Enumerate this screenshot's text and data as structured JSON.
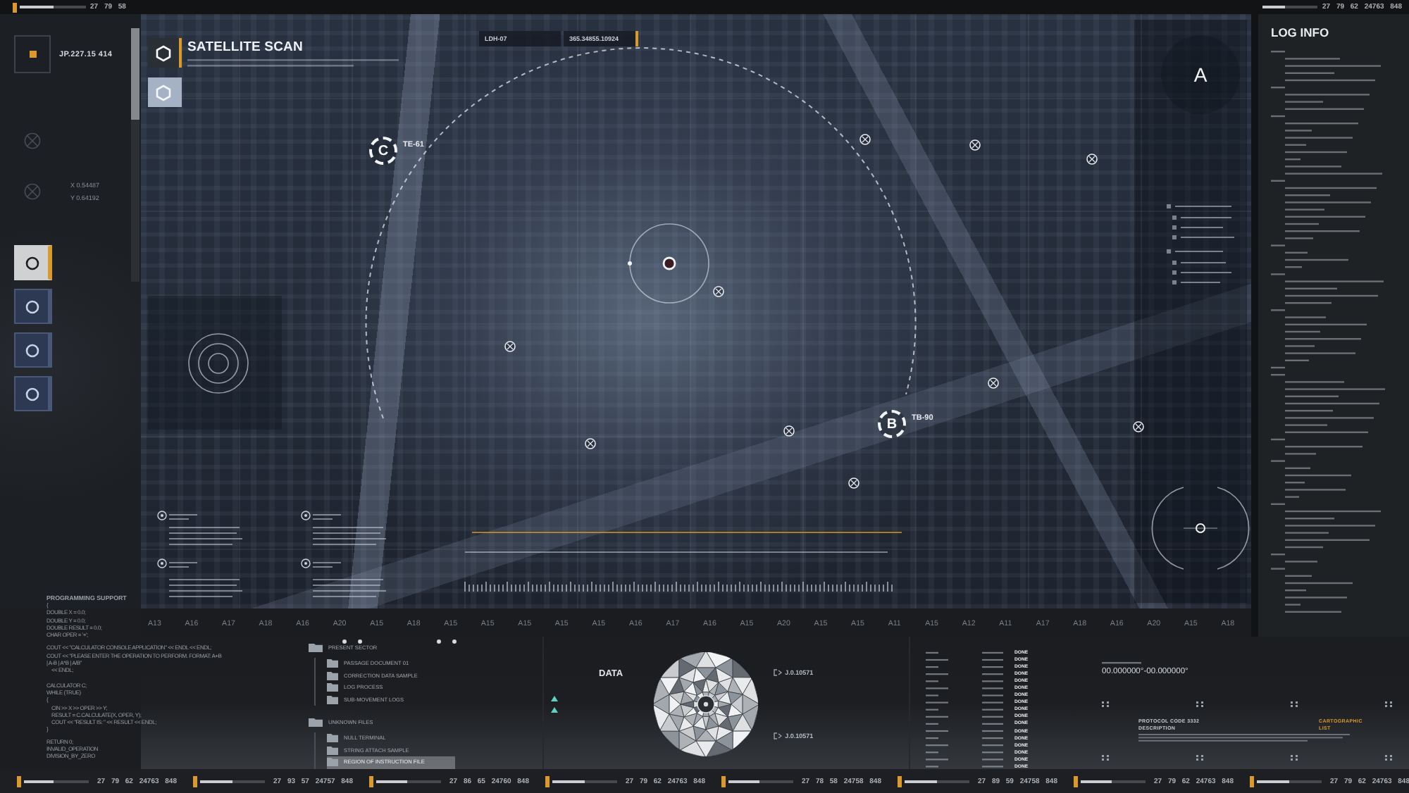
{
  "top_bar": {
    "left": {
      "level": 0.5,
      "readout": "27 79 58"
    },
    "right": {
      "level": 0.42,
      "readout": "27 79 62 24763 848"
    }
  },
  "left_panel": {
    "coordinate": "JP.227.15 414",
    "readouts": [
      "X 0.54487",
      "Y 0.64192"
    ],
    "tools": [
      {
        "selected": true
      },
      {
        "selected": false
      },
      {
        "selected": false
      },
      {
        "selected": false
      }
    ],
    "section_title": "PROGRAMMING SUPPORT"
  },
  "map": {
    "title": "SATELLITE SCAN",
    "scan_modes": [
      {
        "kind": "outline",
        "selected": true
      },
      {
        "kind": "filled",
        "selected": false
      }
    ],
    "location_tag": {
      "label": "LDH-07",
      "value": "365.34855.10924"
    },
    "markers": [
      {
        "kind": "ring",
        "letter": "C",
        "code": "TE-61"
      },
      {
        "kind": "ring",
        "letter": "B",
        "code": "TB-90"
      },
      {
        "kind": "plain",
        "letter": "A"
      }
    ]
  },
  "ruler": [
    "A13",
    "A16",
    "A17",
    "A18",
    "A16",
    "A20",
    "A15",
    "A18",
    "A15",
    "A15",
    "A15",
    "A15",
    "A15",
    "A16",
    "A17",
    "A16",
    "A15",
    "A20",
    "A15",
    "A15",
    "A11",
    "A15",
    "A12",
    "A11",
    "A17",
    "A18",
    "A16",
    "A20",
    "A15",
    "A18"
  ],
  "log_info": {
    "title": "LOG INFO"
  },
  "code_blocks": [
    [
      "{",
      "DOUBLE X = 0.0;",
      "DOUBLE Y = 0.0;",
      "DOUBLE RESULT = 0.0;",
      "CHAR OPER = '+';"
    ],
    [
      "COUT << \"CALCULATOR CONSOLE APPLICATION\" << ENDL << ENDL;",
      "COUT << \"PLEASE ENTER THE OPERATION TO PERFORM. FORMAT: A+B",
      "| A-B | A*B | A/B\"",
      "    << ENDL;"
    ],
    [
      "CALCULATOR C;",
      "WHILE (TRUE)",
      "{",
      "    CIN >> X >> OPER >> Y;",
      "    RESULT = C.CALCULATE(X, OPER, Y);",
      "    COUT << \"RESULT IS: \" << RESULT << ENDL;",
      "}"
    ],
    [
      "RETURN 0;",
      "INVALID_OPERATION",
      "DIVISION_BY_ZERO"
    ]
  ],
  "file_tree": [
    {
      "name": "PRESENT SECTOR",
      "expanded": true,
      "selected": false,
      "children": [
        {
          "name": "PASSAGE DOCUMENT 01",
          "selected": false
        },
        {
          "name": "CORRECTION DATA SAMPLE",
          "selected": false
        },
        {
          "name": "LOG PROCESS",
          "selected": false
        },
        {
          "name": "SUB-MOVEMENT LOGS",
          "selected": false
        }
      ]
    },
    {
      "name": "UNKNOWN FILES",
      "expanded": true,
      "selected": false,
      "children": [
        {
          "name": "NULL TERMINAL",
          "selected": false
        },
        {
          "name": "STRING ATTACH SAMPLE",
          "selected": false
        },
        {
          "name": "REGION OF INSTRUCTION FILE",
          "selected": true
        }
      ]
    }
  ],
  "data_widget": {
    "title": "DATA",
    "readouts": [
      "J.0.10571",
      "J.0.10571"
    ]
  },
  "task_table": {
    "rows": [
      {
        "status": "DONE"
      },
      {
        "status": "DONE"
      },
      {
        "status": "DONE"
      },
      {
        "status": "DONE"
      },
      {
        "status": "DONE"
      },
      {
        "status": "DONE"
      },
      {
        "status": "DONE"
      },
      {
        "status": "DONE"
      },
      {
        "status": "DONE"
      },
      {
        "status": "DONE"
      },
      {
        "status": "DONE"
      },
      {
        "status": "DONE"
      },
      {
        "status": "DONE"
      },
      {
        "status": "DONE"
      },
      {
        "status": "DONE"
      },
      {
        "status": "DONE"
      },
      {
        "status": "DONE"
      }
    ]
  },
  "geocode": {
    "value": "00.000000°-00.000000°"
  },
  "protocol": {
    "code": "PROTOCOL CODE 3332",
    "label": "DESCRIPTION",
    "tags": [
      "CARTOGRAPHIC",
      "LIST"
    ]
  },
  "status_bar": [
    {
      "level": 0.45,
      "readout": "27 79 62 24763 848"
    },
    {
      "level": 0.5,
      "readout": "27 93 57 24757 848"
    },
    {
      "level": 0.48,
      "readout": "27 86 65 24760 848"
    },
    {
      "level": 0.5,
      "readout": "27 79 62 24763 848"
    },
    {
      "level": 0.48,
      "readout": "27 78 58 24758 848"
    },
    {
      "level": 0.5,
      "readout": "27 89 59 24758 848"
    },
    {
      "level": 0.48,
      "readout": "27 79 62 24763 848"
    },
    {
      "level": 0.5,
      "readout": "27 79 62 24763 848"
    }
  ]
}
